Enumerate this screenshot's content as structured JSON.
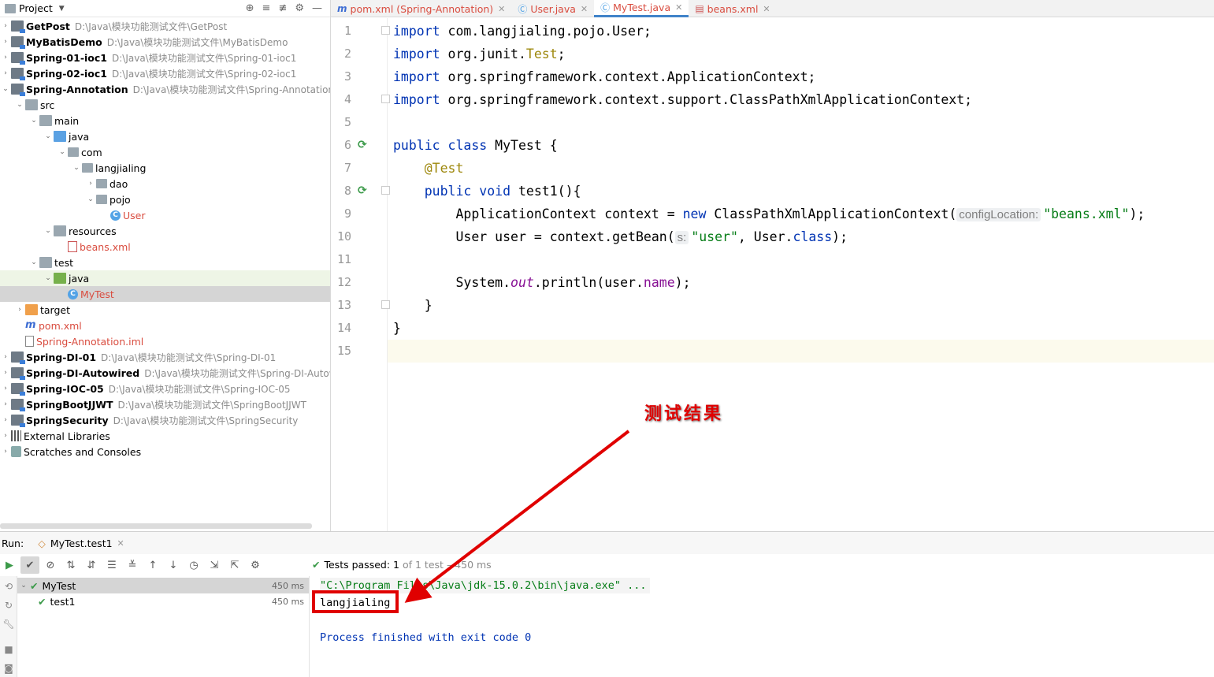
{
  "project": {
    "header_title": "Project",
    "tree": [
      {
        "name": "GetPost",
        "path": "D:\\Java\\模块功能测试文件\\GetPost",
        "kind": "module",
        "depth": 0,
        "arrow": "›"
      },
      {
        "name": "MyBatisDemo",
        "path": "D:\\Java\\模块功能测试文件\\MyBatisDemo",
        "kind": "module",
        "depth": 0,
        "arrow": "›"
      },
      {
        "name": "Spring-01-ioc1",
        "path": "D:\\Java\\模块功能测试文件\\Spring-01-ioc1",
        "kind": "module",
        "depth": 0,
        "arrow": "›"
      },
      {
        "name": "Spring-02-ioc1",
        "path": "D:\\Java\\模块功能测试文件\\Spring-02-ioc1",
        "kind": "module",
        "depth": 0,
        "arrow": "›"
      },
      {
        "name": "Spring-Annotation",
        "path": "D:\\Java\\模块功能测试文件\\Spring-Annotation",
        "kind": "module",
        "depth": 0,
        "arrow": "⌄"
      },
      {
        "name": "src",
        "path": "",
        "kind": "folder",
        "depth": 1,
        "arrow": "⌄"
      },
      {
        "name": "main",
        "path": "",
        "kind": "folder",
        "depth": 2,
        "arrow": "⌄"
      },
      {
        "name": "java",
        "path": "",
        "kind": "folder-src",
        "depth": 3,
        "arrow": "⌄"
      },
      {
        "name": "com",
        "path": "",
        "kind": "pkg",
        "depth": 4,
        "arrow": "⌄"
      },
      {
        "name": "langjialing",
        "path": "",
        "kind": "pkg",
        "depth": 5,
        "arrow": "⌄"
      },
      {
        "name": "dao",
        "path": "",
        "kind": "pkg",
        "depth": 6,
        "arrow": "›"
      },
      {
        "name": "pojo",
        "path": "",
        "kind": "pkg",
        "depth": 6,
        "arrow": "⌄"
      },
      {
        "name": "User",
        "path": "",
        "kind": "cls",
        "depth": 7,
        "arrow": ""
      },
      {
        "name": "resources",
        "path": "",
        "kind": "folder-res",
        "depth": 3,
        "arrow": "⌄"
      },
      {
        "name": "beans.xml",
        "path": "",
        "kind": "xml",
        "depth": 4,
        "arrow": ""
      },
      {
        "name": "test",
        "path": "",
        "kind": "folder",
        "depth": 2,
        "arrow": "⌄"
      },
      {
        "name": "java",
        "path": "",
        "kind": "folder-test",
        "depth": 3,
        "arrow": "⌄"
      },
      {
        "name": "MyTest",
        "path": "",
        "kind": "cls",
        "depth": 4,
        "arrow": ""
      },
      {
        "name": "target",
        "path": "",
        "kind": "folder-target",
        "depth": 1,
        "arrow": "›"
      },
      {
        "name": "pom.xml",
        "path": "",
        "kind": "maven",
        "depth": 1,
        "arrow": ""
      },
      {
        "name": "Spring-Annotation.iml",
        "path": "",
        "kind": "iml",
        "depth": 1,
        "arrow": ""
      },
      {
        "name": "Spring-DI-01",
        "path": "D:\\Java\\模块功能测试文件\\Spring-DI-01",
        "kind": "module",
        "depth": 0,
        "arrow": "›"
      },
      {
        "name": "Spring-DI-Autowired",
        "path": "D:\\Java\\模块功能测试文件\\Spring-DI-Autowi",
        "kind": "module",
        "depth": 0,
        "arrow": "›"
      },
      {
        "name": "Spring-IOC-05",
        "path": "D:\\Java\\模块功能测试文件\\Spring-IOC-05",
        "kind": "module",
        "depth": 0,
        "arrow": "›"
      },
      {
        "name": "SpringBootJJWT",
        "path": "D:\\Java\\模块功能测试文件\\SpringBootJJWT",
        "kind": "module",
        "depth": 0,
        "arrow": "›"
      },
      {
        "name": "SpringSecurity",
        "path": "D:\\Java\\模块功能测试文件\\SpringSecurity",
        "kind": "module",
        "depth": 0,
        "arrow": "›"
      },
      {
        "name": "External Libraries",
        "path": "",
        "kind": "libs",
        "depth": 0,
        "arrow": "›"
      },
      {
        "name": "Scratches and Consoles",
        "path": "",
        "kind": "scratch",
        "depth": 0,
        "arrow": "›"
      }
    ],
    "selected_item": "MyTest",
    "highlighted_item": "java (test)"
  },
  "tabs": [
    {
      "icon": "m",
      "label": "pom.xml (Spring-Annotation)",
      "kind": "maven",
      "active": false
    },
    {
      "icon": "Ⓒ",
      "label": "User.java",
      "kind": "java",
      "active": false
    },
    {
      "icon": "Ⓒ",
      "label": "MyTest.java",
      "kind": "java",
      "active": true
    },
    {
      "icon": "▤",
      "label": "beans.xml",
      "kind": "xml",
      "active": false
    }
  ],
  "editor": {
    "line_numbers": [
      "1",
      "2",
      "3",
      "4",
      "5",
      "6",
      "7",
      "8",
      "9",
      "10",
      "11",
      "12",
      "13",
      "14",
      "15"
    ],
    "code": {
      "l1_kw": "import",
      "l1_rest": " com.langjialing.pojo.User;",
      "l2_kw": "import",
      "l2_a": " org.junit.",
      "l2_ann": "Test",
      "l2_b": ";",
      "l3_kw": "import",
      "l3_rest": " org.springframework.context.ApplicationContext;",
      "l4_kw": "import",
      "l4_rest": " org.springframework.context.support.ClassPathXmlApplicationContext;",
      "l6_kw1": "public",
      "l6_kw2": " class",
      "l6_rest": " MyTest {",
      "l7_ann": "@Test",
      "l8_kw1": "public",
      "l8_kw2": " void",
      "l8_rest": " test1(){",
      "l9_a": "ApplicationContext context = ",
      "l9_kw": "new",
      "l9_b": " ClassPathXmlApplicationContext(",
      "l9_hint": "configLocation:",
      "l9_str": "\"beans.xml\"",
      "l9_c": ");",
      "l10_a": "User user = context.getBean(",
      "l10_hint": "s:",
      "l10_str": "\"user\"",
      "l10_b": ", User.",
      "l10_kw": "class",
      "l10_c": ");",
      "l12_a": "System.",
      "l12_out": "out",
      "l12_b": ".println(user.",
      "l12_fld": "name",
      "l12_c": ");",
      "l13": "}",
      "l14": "}"
    }
  },
  "annotation": {
    "label": "测试结果",
    "color": "#e00000"
  },
  "run": {
    "label": "Run:",
    "tab_label": "MyTest.test1",
    "status_prefix": "Tests passed:",
    "status_count": "1",
    "status_suffix": "of 1 test",
    "status_time": "– 450 ms",
    "tests": [
      {
        "name": "MyTest",
        "time": "450 ms"
      },
      {
        "name": "test1",
        "time": "450 ms"
      }
    ],
    "console": {
      "cmd": "\"C:\\Program Files\\Java\\jdk-15.0.2\\bin\\java.exe\" ...",
      "output": "langjialing",
      "exit": "Process finished with exit code 0"
    }
  },
  "colors": {
    "keyword": "#0033b3",
    "annotation": "#9e880d",
    "string": "#067d17",
    "field": "#871094",
    "pass": "#3b9a49",
    "accent_tab": "#4083c9"
  }
}
